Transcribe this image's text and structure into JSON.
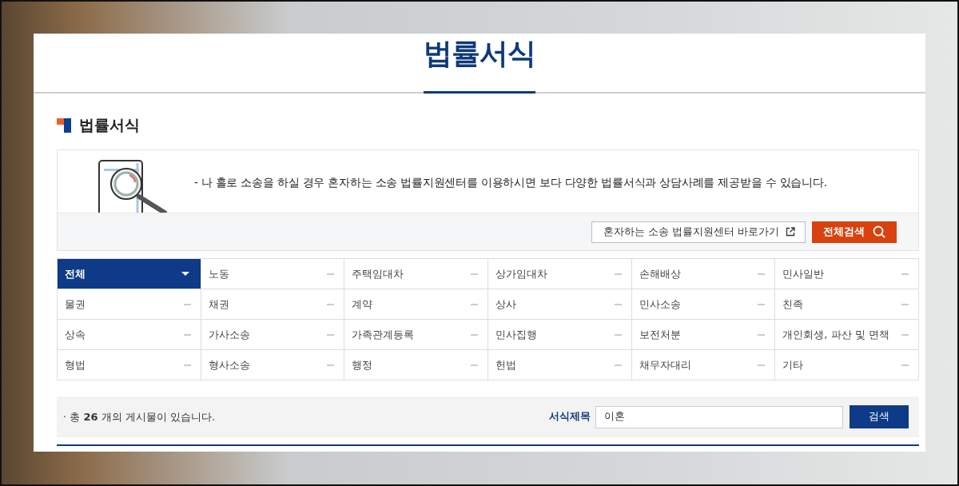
{
  "page_title": "법률서식",
  "section": {
    "title": "법률서식"
  },
  "notice": {
    "text": "- 나 홀로 소송을 하실 경우 혼자하는 소송 법률지원센터를 이용하시면 보다 다양한 법률서식과 상담사례를 제공받을 수 있습니다.",
    "link_button": "혼자하는 소송 법률지원센터 바로가기",
    "search_all_button": "전체검색"
  },
  "categories": [
    {
      "label": "전체",
      "selected": true
    },
    {
      "label": "노동",
      "selected": false
    },
    {
      "label": "주택임대차",
      "selected": false
    },
    {
      "label": "상가임대차",
      "selected": false
    },
    {
      "label": "손해배상",
      "selected": false
    },
    {
      "label": "민사일반",
      "selected": false
    },
    {
      "label": "물권",
      "selected": false
    },
    {
      "label": "채권",
      "selected": false
    },
    {
      "label": "계약",
      "selected": false
    },
    {
      "label": "상사",
      "selected": false
    },
    {
      "label": "민사소송",
      "selected": false
    },
    {
      "label": "친족",
      "selected": false
    },
    {
      "label": "상속",
      "selected": false
    },
    {
      "label": "가사소송",
      "selected": false
    },
    {
      "label": "가족관계등록",
      "selected": false
    },
    {
      "label": "민사집행",
      "selected": false
    },
    {
      "label": "보전처분",
      "selected": false
    },
    {
      "label": "개인회생, 파산 및 면책",
      "selected": false
    },
    {
      "label": "형법",
      "selected": false
    },
    {
      "label": "형사소송",
      "selected": false
    },
    {
      "label": "행정",
      "selected": false
    },
    {
      "label": "헌법",
      "selected": false
    },
    {
      "label": "채무자대리",
      "selected": false
    },
    {
      "label": "기타",
      "selected": false
    }
  ],
  "search_bar": {
    "count_text": "· 총 **26** 개의 게시물이 있습니다.",
    "field_label": "서식제목",
    "field_value": "이혼",
    "search_button": "검색"
  }
}
